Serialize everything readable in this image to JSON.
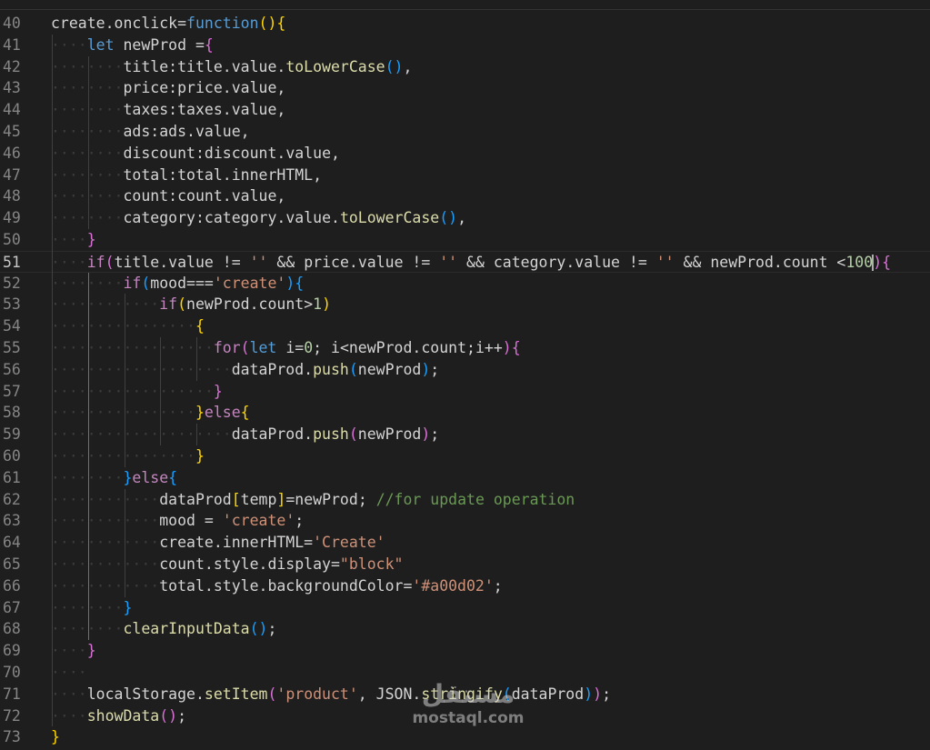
{
  "colors": {
    "background": "#1e1e1e",
    "line_number": "#858585",
    "variable": "#d4d4d4",
    "keyword": "#569cd6",
    "control_keyword": "#c586c0",
    "function": "#dcdcaa",
    "string": "#ce9178",
    "number": "#b5cea8",
    "comment": "#6a9955",
    "bracket_level_1": "#ffd700",
    "bracket_level_2": "#da70d6",
    "bracket_level_3": "#179fff"
  },
  "cursor": {
    "line": 51,
    "column": 73
  },
  "watermark": {
    "arabic": "مستقل",
    "latin": "mostaql.com"
  },
  "lines": [
    {
      "n": "40",
      "indent": 0,
      "tokens": [
        [
          "create",
          "v"
        ],
        [
          ".",
          "p"
        ],
        [
          "onclick",
          "v"
        ],
        [
          "=",
          "p"
        ],
        [
          "function",
          "k"
        ],
        [
          "()",
          "b1"
        ],
        [
          "{",
          "b1"
        ]
      ]
    },
    {
      "n": "41",
      "indent": 1,
      "tokens": [
        [
          "let",
          "k"
        ],
        [
          " ",
          "p"
        ],
        [
          "newProd",
          "v"
        ],
        [
          " =",
          "p"
        ],
        [
          "{",
          "b2"
        ]
      ]
    },
    {
      "n": "42",
      "indent": 2,
      "tokens": [
        [
          "title",
          "v"
        ],
        [
          ":",
          "p"
        ],
        [
          "title",
          "v"
        ],
        [
          ".",
          "p"
        ],
        [
          "value",
          "v"
        ],
        [
          ".",
          "p"
        ],
        [
          "toLowerCase",
          "f"
        ],
        [
          "()",
          "b3"
        ],
        [
          ",",
          "p"
        ]
      ]
    },
    {
      "n": "43",
      "indent": 2,
      "tokens": [
        [
          "price",
          "v"
        ],
        [
          ":",
          "p"
        ],
        [
          "price",
          "v"
        ],
        [
          ".",
          "p"
        ],
        [
          "value",
          "v"
        ],
        [
          ",",
          "p"
        ]
      ]
    },
    {
      "n": "44",
      "indent": 2,
      "tokens": [
        [
          "taxes",
          "v"
        ],
        [
          ":",
          "p"
        ],
        [
          "taxes",
          "v"
        ],
        [
          ".",
          "p"
        ],
        [
          "value",
          "v"
        ],
        [
          ",",
          "p"
        ]
      ]
    },
    {
      "n": "45",
      "indent": 2,
      "tokens": [
        [
          "ads",
          "v"
        ],
        [
          ":",
          "p"
        ],
        [
          "ads",
          "v"
        ],
        [
          ".",
          "p"
        ],
        [
          "value",
          "v"
        ],
        [
          ",",
          "p"
        ]
      ]
    },
    {
      "n": "46",
      "indent": 2,
      "tokens": [
        [
          "discount",
          "v"
        ],
        [
          ":",
          "p"
        ],
        [
          "discount",
          "v"
        ],
        [
          ".",
          "p"
        ],
        [
          "value",
          "v"
        ],
        [
          ",",
          "p"
        ]
      ]
    },
    {
      "n": "47",
      "indent": 2,
      "tokens": [
        [
          "total",
          "v"
        ],
        [
          ":",
          "p"
        ],
        [
          "total",
          "v"
        ],
        [
          ".",
          "p"
        ],
        [
          "innerHTML",
          "v"
        ],
        [
          ",",
          "p"
        ]
      ]
    },
    {
      "n": "48",
      "indent": 2,
      "tokens": [
        [
          "count",
          "v"
        ],
        [
          ":",
          "p"
        ],
        [
          "count",
          "v"
        ],
        [
          ".",
          "p"
        ],
        [
          "value",
          "v"
        ],
        [
          ",",
          "p"
        ]
      ]
    },
    {
      "n": "49",
      "indent": 2,
      "tokens": [
        [
          "category",
          "v"
        ],
        [
          ":",
          "p"
        ],
        [
          "category",
          "v"
        ],
        [
          ".",
          "p"
        ],
        [
          "value",
          "v"
        ],
        [
          ".",
          "p"
        ],
        [
          "toLowerCase",
          "f"
        ],
        [
          "()",
          "b3"
        ],
        [
          ",",
          "p"
        ]
      ]
    },
    {
      "n": "50",
      "indent": 1,
      "tokens": [
        [
          "}",
          "b2"
        ]
      ]
    },
    {
      "n": "51",
      "indent": 1,
      "tokens": [
        [
          "if",
          "c"
        ],
        [
          "(",
          "b2"
        ],
        [
          "title",
          "v"
        ],
        [
          ".",
          "p"
        ],
        [
          "value",
          "v"
        ],
        [
          " != ",
          "p"
        ],
        [
          "''",
          "s"
        ],
        [
          " && ",
          "p"
        ],
        [
          "price",
          "v"
        ],
        [
          ".",
          "p"
        ],
        [
          "value",
          "v"
        ],
        [
          " != ",
          "p"
        ],
        [
          "''",
          "s"
        ],
        [
          " && ",
          "p"
        ],
        [
          "category",
          "v"
        ],
        [
          ".",
          "p"
        ],
        [
          "value",
          "v"
        ],
        [
          " != ",
          "p"
        ],
        [
          "''",
          "s"
        ],
        [
          " && ",
          "p"
        ],
        [
          "newProd",
          "v"
        ],
        [
          ".",
          "p"
        ],
        [
          "count",
          "v"
        ],
        [
          " <",
          "p"
        ],
        [
          "100",
          "n"
        ],
        [
          "|",
          "cursor"
        ],
        [
          ")",
          "b2"
        ],
        [
          "{",
          "b2"
        ]
      ]
    },
    {
      "n": "52",
      "indent": 2,
      "tokens": [
        [
          "if",
          "c"
        ],
        [
          "(",
          "b3"
        ],
        [
          "mood",
          "v"
        ],
        [
          "===",
          "p"
        ],
        [
          "'create'",
          "s"
        ],
        [
          ")",
          "b3"
        ],
        [
          "{",
          "b3"
        ]
      ]
    },
    {
      "n": "53",
      "indent": 3,
      "tokens": [
        [
          "if",
          "c"
        ],
        [
          "(",
          "b1"
        ],
        [
          "newProd",
          "v"
        ],
        [
          ".",
          "p"
        ],
        [
          "count",
          "v"
        ],
        [
          ">",
          "p"
        ],
        [
          "1",
          "n"
        ],
        [
          ")",
          "b1"
        ]
      ]
    },
    {
      "n": "54",
      "indent": 4,
      "tokens": [
        [
          "{",
          "b1"
        ]
      ]
    },
    {
      "n": "55",
      "indent": 4,
      "pad": 1,
      "tokens": [
        [
          "for",
          "c"
        ],
        [
          "(",
          "b2"
        ],
        [
          "let",
          "k"
        ],
        [
          " ",
          "p"
        ],
        [
          "i",
          "v"
        ],
        [
          "=",
          "p"
        ],
        [
          "0",
          "n"
        ],
        [
          "; ",
          "p"
        ],
        [
          "i",
          "v"
        ],
        [
          "<",
          "p"
        ],
        [
          "newProd",
          "v"
        ],
        [
          ".",
          "p"
        ],
        [
          "count",
          "v"
        ],
        [
          ";",
          "p"
        ],
        [
          "i",
          "v"
        ],
        [
          "++",
          "p"
        ],
        [
          ")",
          "b2"
        ],
        [
          "{",
          "b2"
        ]
      ]
    },
    {
      "n": "56",
      "indent": 5,
      "tokens": [
        [
          "dataProd",
          "v"
        ],
        [
          ".",
          "p"
        ],
        [
          "push",
          "f"
        ],
        [
          "(",
          "b3"
        ],
        [
          "newProd",
          "v"
        ],
        [
          ")",
          "b3"
        ],
        [
          ";",
          "p"
        ]
      ]
    },
    {
      "n": "57",
      "indent": 4,
      "pad": 1,
      "tokens": [
        [
          "}",
          "b2"
        ]
      ]
    },
    {
      "n": "58",
      "indent": 4,
      "tokens": [
        [
          "}",
          "b1"
        ],
        [
          "else",
          "c"
        ],
        [
          "{",
          "b1"
        ]
      ]
    },
    {
      "n": "59",
      "indent": 5,
      "tokens": [
        [
          "dataProd",
          "v"
        ],
        [
          ".",
          "p"
        ],
        [
          "push",
          "f"
        ],
        [
          "(",
          "b2"
        ],
        [
          "newProd",
          "v"
        ],
        [
          ")",
          "b2"
        ],
        [
          ";",
          "p"
        ]
      ]
    },
    {
      "n": "60",
      "indent": 4,
      "tokens": [
        [
          "}",
          "b1"
        ]
      ]
    },
    {
      "n": "61",
      "indent": 2,
      "tokens": [
        [
          "}",
          "b3"
        ],
        [
          "else",
          "c"
        ],
        [
          "{",
          "b3"
        ]
      ]
    },
    {
      "n": "62",
      "indent": 3,
      "tokens": [
        [
          "dataProd",
          "v"
        ],
        [
          "[",
          "b1"
        ],
        [
          "temp",
          "v"
        ],
        [
          "]",
          "b1"
        ],
        [
          "=",
          "p"
        ],
        [
          "newProd",
          "v"
        ],
        [
          "; ",
          "p"
        ],
        [
          "//for update operation",
          "cm"
        ]
      ]
    },
    {
      "n": "63",
      "indent": 3,
      "tokens": [
        [
          "mood",
          "v"
        ],
        [
          " = ",
          "p"
        ],
        [
          "'create'",
          "s"
        ],
        [
          ";",
          "p"
        ]
      ]
    },
    {
      "n": "64",
      "indent": 3,
      "tokens": [
        [
          "create",
          "v"
        ],
        [
          ".",
          "p"
        ],
        [
          "innerHTML",
          "v"
        ],
        [
          "=",
          "p"
        ],
        [
          "'Create'",
          "s"
        ]
      ]
    },
    {
      "n": "65",
      "indent": 3,
      "tokens": [
        [
          "count",
          "v"
        ],
        [
          ".",
          "p"
        ],
        [
          "style",
          "v"
        ],
        [
          ".",
          "p"
        ],
        [
          "display",
          "v"
        ],
        [
          "=",
          "p"
        ],
        [
          "\"block\"",
          "s"
        ]
      ]
    },
    {
      "n": "66",
      "indent": 3,
      "tokens": [
        [
          "total",
          "v"
        ],
        [
          ".",
          "p"
        ],
        [
          "style",
          "v"
        ],
        [
          ".",
          "p"
        ],
        [
          "backgroundColor",
          "v"
        ],
        [
          "=",
          "p"
        ],
        [
          "'#a00d02'",
          "s"
        ],
        [
          ";",
          "p"
        ]
      ]
    },
    {
      "n": "67",
      "indent": 2,
      "tokens": [
        [
          "}",
          "b3"
        ]
      ]
    },
    {
      "n": "68",
      "indent": 2,
      "tokens": [
        [
          "clearInputData",
          "f"
        ],
        [
          "()",
          "b3"
        ],
        [
          ";",
          "p"
        ]
      ]
    },
    {
      "n": "69",
      "indent": 1,
      "tokens": [
        [
          "}",
          "b2"
        ]
      ]
    },
    {
      "n": "70",
      "indent": 1,
      "tokens": []
    },
    {
      "n": "71",
      "indent": 1,
      "tokens": [
        [
          "localStorage",
          "v"
        ],
        [
          ".",
          "p"
        ],
        [
          "setItem",
          "f"
        ],
        [
          "(",
          "b2"
        ],
        [
          "'product'",
          "s"
        ],
        [
          ", ",
          "p"
        ],
        [
          "JSON",
          "v"
        ],
        [
          ".",
          "p"
        ],
        [
          "stringify",
          "f"
        ],
        [
          "(",
          "b3"
        ],
        [
          "dataProd",
          "v"
        ],
        [
          ")",
          "b3"
        ],
        [
          ")",
          "b2"
        ],
        [
          ";",
          "p"
        ]
      ]
    },
    {
      "n": "72",
      "indent": 1,
      "tokens": [
        [
          "showData",
          "f"
        ],
        [
          "()",
          "b2"
        ],
        [
          ";",
          "p"
        ]
      ]
    },
    {
      "n": "73",
      "indent": 0,
      "tokens": [
        [
          "}",
          "b1"
        ]
      ]
    }
  ]
}
